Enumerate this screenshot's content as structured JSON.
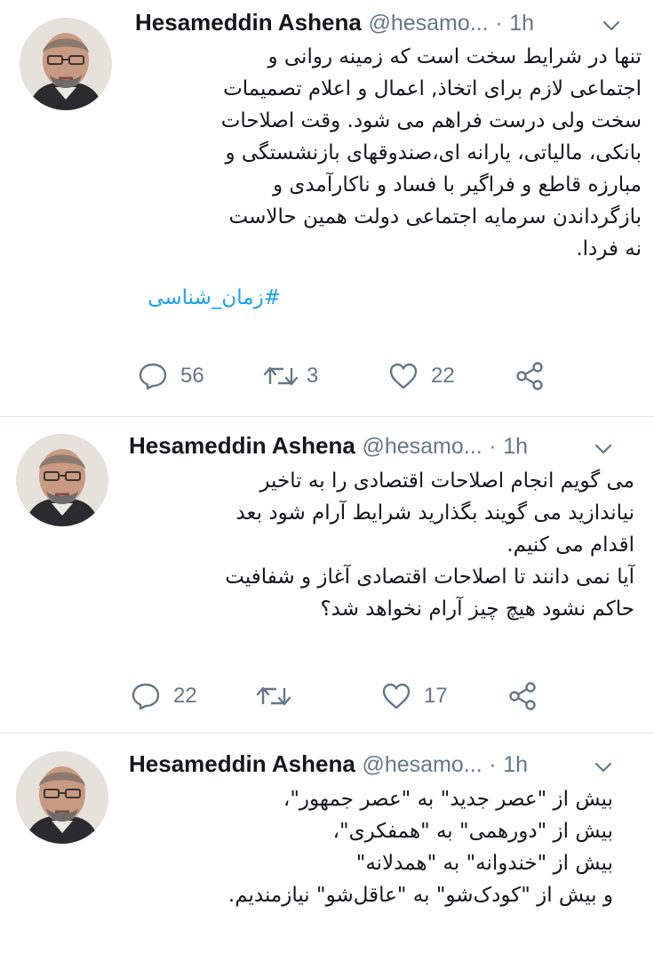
{
  "colors": {
    "accent": "#1da1f2",
    "secondary_text": "#657786",
    "divider": "#e1e8ed"
  },
  "tweets": [
    {
      "author": {
        "name": "Hesameddin Ashena",
        "handle": "@hesamo...",
        "avatar_icon": "profile-photo"
      },
      "separator": "·",
      "time": "1h",
      "text": "تنها در شرایط سخت است که زمینه روانی و\nاجتماعی لازم برای اتخاذ, اعمال و اعلام تصمیمات\nسخت ولی درست فراهم می شود. وقت اصلاحات\nبانکی، مالیاتی، یارانه ای،صندوقهای بازنشستگی و\nمبارزه قاطع و فراگیر با فساد و ناکارآمدی و\nبازگرداندن سرمایه اجتماعی دولت همین حالاست\nنه فردا.",
      "hashtag": "#زمان_شناسی",
      "replies": "56",
      "retweets": "3",
      "likes": "22"
    },
    {
      "author": {
        "name": "Hesameddin Ashena",
        "handle": "@hesamo...",
        "avatar_icon": "profile-photo"
      },
      "separator": "·",
      "time": "1h",
      "text": "می گویم انجام اصلاحات اقتصادی را به تاخیر\nنیاندازید می گویند بگذارید شرایط آرام شود بعد\nاقدام می کنیم.\nآیا نمی دانند تا اصلاحات اقتصادی آغاز و شفافیت\nحاکم نشود هیچ چیز آرام نخواهد شد؟",
      "replies": "22",
      "retweets": "",
      "likes": "17"
    },
    {
      "author": {
        "name": "Hesameddin Ashena",
        "handle": "@hesamo...",
        "avatar_icon": "profile-photo"
      },
      "separator": "·",
      "time": "1h",
      "text": "بیش از \"عصر جدید\" به \"عصر جمهور\"،\nبیش از \"دورهمی\" به \"همفکری\"،\nبیش از \"خندوانه\" به \"همدلانه\"\nو بیش از \"کودک‌شو\" به \"عاقل‌شو\" نیازمندیم."
    }
  ]
}
